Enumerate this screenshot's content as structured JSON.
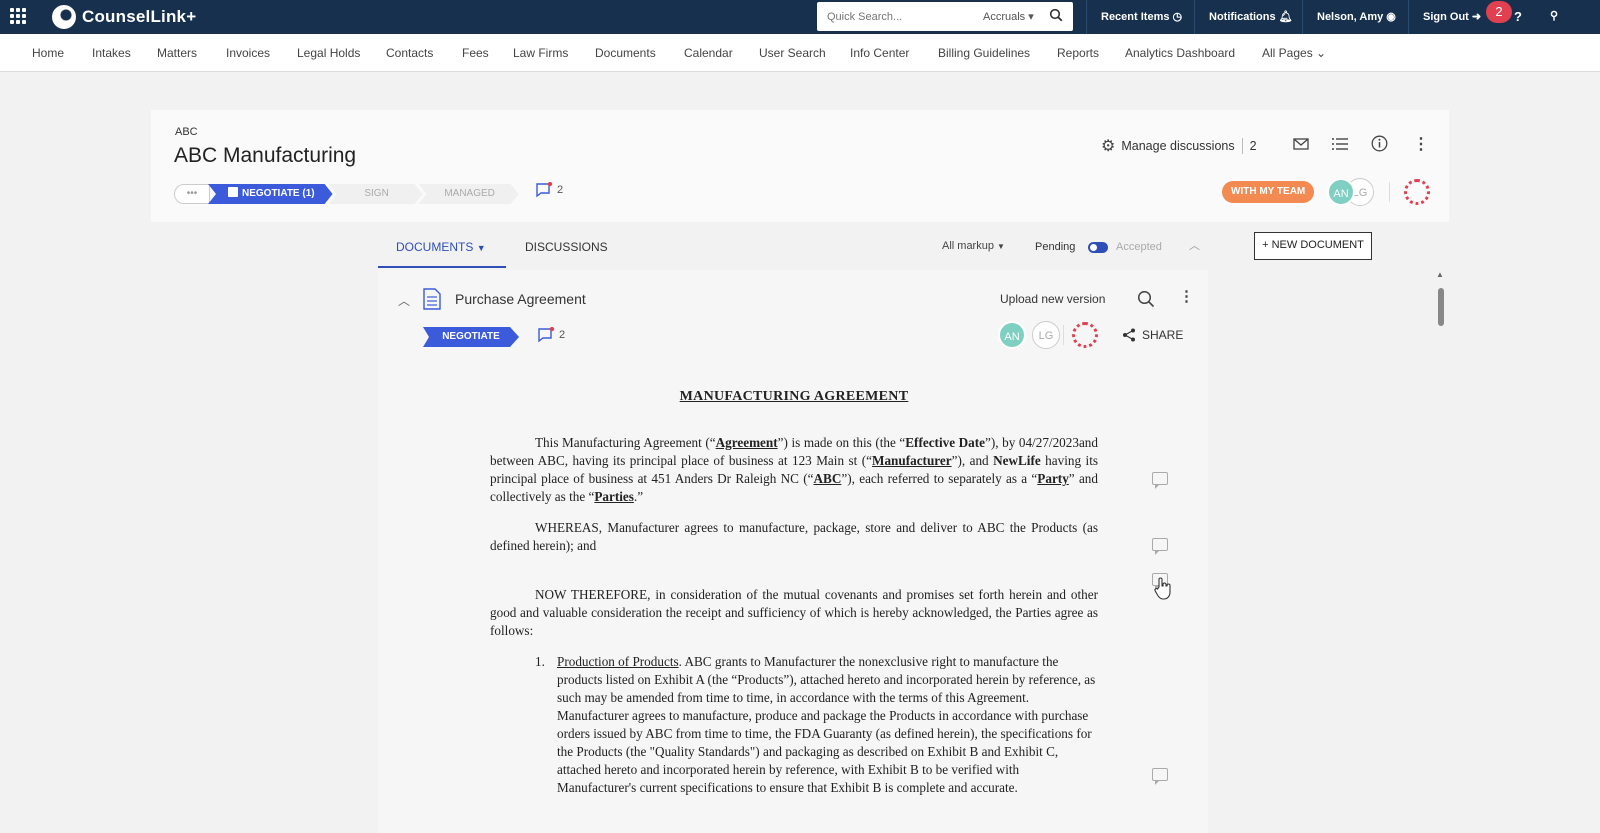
{
  "app": {
    "name": "CounselLink+"
  },
  "search": {
    "placeholder": "Quick Search...",
    "scope": "Accruals"
  },
  "topbar": {
    "recent_items": "Recent Items",
    "notifications": "Notifications",
    "user": "Nelson, Amy",
    "sign_out": "Sign Out",
    "badge_count": "2"
  },
  "nav": [
    "Home",
    "Intakes",
    "Matters",
    "Invoices",
    "Legal Holds",
    "Contacts",
    "Fees",
    "Law Firms",
    "Documents",
    "Calendar",
    "User Search",
    "Info Center",
    "Billing Guidelines",
    "Reports",
    "Analytics Dashboard",
    "All Pages"
  ],
  "matter": {
    "eyebrow": "ABC",
    "title": "ABC Manufacturing",
    "stage_dots": "•••",
    "stages": [
      "NEGOTIATE (1)",
      "SIGN",
      "MANAGED"
    ],
    "discussion_count": "2",
    "manage_discussions": "Manage discussions",
    "manage_count": "2",
    "team_status": "WITH MY TEAM",
    "avatars": [
      "AN",
      "LG"
    ]
  },
  "tabs": {
    "documents": "DOCUMENTS",
    "discussions": "DISCUSSIONS",
    "markup": "All markup",
    "pending": "Pending",
    "accepted": "Accepted",
    "new_document": "+ NEW DOCUMENT"
  },
  "document": {
    "name": "Purchase Agreement",
    "upload": "Upload new version",
    "stage": "NEGOTIATE",
    "comment_count": "2",
    "share": "SHARE",
    "avatars": [
      "AN",
      "LG"
    ],
    "heading": "MANUFACTURING AGREEMENT",
    "p1": {
      "a": "This Manufacturing Agreement (“",
      "b": "Agreement",
      "c": "”) is made on this  (the “",
      "d": "Effective Date",
      "e": "”), by 04/27/2023and between ABC, having its principal place of business at 123 Main st (“",
      "f": "Manufacturer",
      "g": "”), and ",
      "h": "NewLife",
      "i": " having its principal place of business at 451 Anders Dr Raleigh NC (“",
      "j": "ABC",
      "k": "”), each referred to separately as a “",
      "l": "Party",
      "m": "” and collectively as the “",
      "n": "Parties",
      "o": ".”"
    },
    "p2": "WHEREAS, Manufacturer agrees to manufacture, package, store and deliver to ABC the Products (as defined herein); and",
    "p3": "NOW THEREFORE, in consideration of the mutual covenants and promises set forth herein and other good and valuable consideration the receipt and sufficiency of which is hereby acknowledged, the Parties agree as follows:",
    "item1": {
      "num": "1.",
      "title": "Production of Products",
      "body": ". ABC grants to Manufacturer the nonexclusive right to manufacture the products listed on Exhibit A (the “Products”), attached hereto and incorporated herein by reference, as such may be amended from time to time, in accordance with the terms of this Agreement. Manufacturer agrees to manufacture, produce and package the Products in accordance with purchase orders issued by ABC from time to time, the FDA Guaranty (as defined herein), the specifications for the Products (the \"Quality Standards\") and packaging as described on Exhibit B and Exhibit C, attached hereto and incorporated herein by reference, with Exhibit B to be verified with Manufacturer's current specifications to ensure that Exhibit B is complete and accurate."
    }
  },
  "colors": {
    "topbar": "#17304d",
    "accent": "#3b5bdb",
    "team": "#f28a52",
    "alert": "#e04050"
  }
}
